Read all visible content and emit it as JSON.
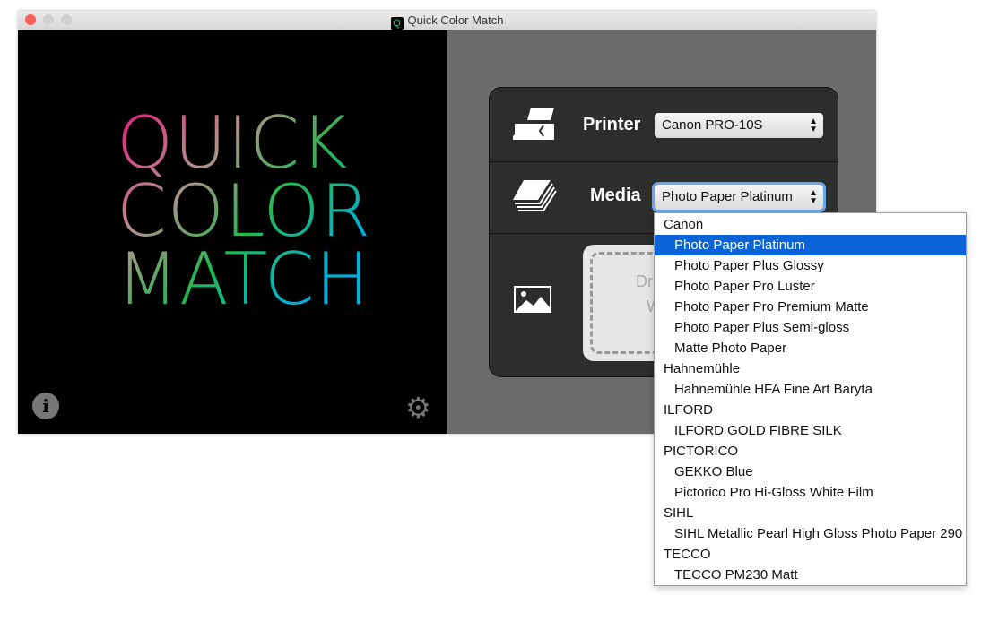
{
  "window": {
    "title": "Quick Color Match",
    "app_icon": "Q"
  },
  "logo": {
    "lines": [
      "QUICK",
      "COLOR",
      "MATCH"
    ]
  },
  "printer": {
    "label": "Printer",
    "value": "Canon PRO-10S"
  },
  "media": {
    "label": "Media",
    "value": "Photo Paper Platinum"
  },
  "drop_zone": {
    "text_fragment_1": "Dr",
    "text_fragment_2": "W"
  },
  "menu": {
    "items": [
      {
        "label": "Canon",
        "group": true
      },
      {
        "label": "Photo Paper Platinum",
        "selected": true
      },
      {
        "label": "Photo Paper Plus Glossy"
      },
      {
        "label": "Photo Paper Pro Luster"
      },
      {
        "label": "Photo Paper Pro Premium Matte"
      },
      {
        "label": "Photo Paper Plus Semi-gloss"
      },
      {
        "label": "Matte Photo Paper"
      },
      {
        "label": "Hahnemühle",
        "group": true
      },
      {
        "label": "Hahnemühle HFA Fine Art Baryta"
      },
      {
        "label": "ILFORD",
        "group": true
      },
      {
        "label": "ILFORD GOLD FIBRE SILK"
      },
      {
        "label": "PICTORICO",
        "group": true
      },
      {
        "label": "GEKKO Blue"
      },
      {
        "label": "Pictorico Pro Hi-Gloss White Film"
      },
      {
        "label": "SIHL",
        "group": true
      },
      {
        "label": "SIHL Metallic Pearl High Gloss Photo Paper 290"
      },
      {
        "label": "TECCO",
        "group": true
      },
      {
        "label": "TECCO PM230 Matt"
      }
    ]
  },
  "colors": {
    "highlight": "#0a64d8",
    "close": "#fc5f57"
  }
}
